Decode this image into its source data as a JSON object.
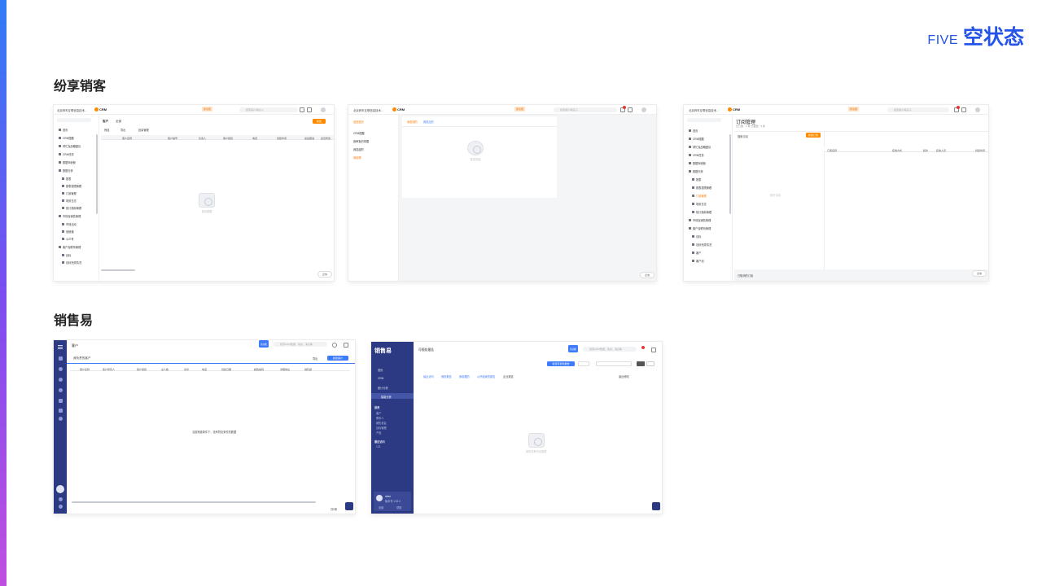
{
  "header": {
    "brand_en": "FIVE",
    "brand_zh": "空状态"
  },
  "sections": {
    "fenxiang_title": "纷享销客",
    "xiaoshouyi_title": "销售易"
  },
  "common": {
    "crm_label": "CRM",
    "badge_text": "新功能",
    "chat_label": "企信",
    "search_placeholder": "搜索客户/联系人"
  },
  "shot1": {
    "company": "北京奔车互联信息技术...",
    "nav": [
      "首页",
      "CRM提醒",
      "帮忙及战略团队",
      "CRM任务",
      "数据驾驶舱",
      "数据分析",
      "报表",
      "报表权限管理",
      "订阅管理",
      "场景日志",
      "统计指标管理",
      "市场及销售管理",
      "市场活动",
      "营销通",
      "公众号",
      "客户及联系管理",
      "目标",
      "目标完成情况"
    ],
    "tab": "客户",
    "filter": "全部",
    "toolbar": [
      "筛选",
      "导出",
      "批量管理"
    ],
    "new_btn": "新建",
    "columns": [
      "客户名称",
      "客户编号",
      "负责人",
      "客户级别",
      "电话",
      "创建时间",
      "最后跟进",
      "最近修改"
    ],
    "empty_text": "暂无数据"
  },
  "shot2": {
    "back": "返回首页",
    "nav": [
      "CRM提醒",
      "我审批的单据",
      "我发起的",
      "我处理"
    ],
    "tabs": [
      "我收到的",
      "我发出的"
    ],
    "empty_text": "暂无内容"
  },
  "shot3": {
    "title": "订阅管理",
    "subtitle": "已订阅：1 条 已发送：3 条",
    "nav": [
      "首页",
      "CRM提醒",
      "帮忙及战略团队",
      "CRM任务",
      "数据驾驶舱",
      "数据分析",
      "报表",
      "报表权限管理",
      "订阅管理",
      "场景日志",
      "统计指标管理",
      "市场及销售管理",
      "客户及联系管理",
      "目标",
      "目标完成情况",
      "客户",
      "客户池"
    ],
    "search_label": "搜索订阅",
    "new_btn": "新建订阅",
    "columns": [
      "订阅名称",
      "接收方式",
      "频次",
      "接收人员",
      "创建时间"
    ],
    "empty_text": "暂无订阅",
    "footer": "已取消的订阅"
  },
  "shot4": {
    "title": "客户",
    "view": "我负责的客户",
    "export_btn": "导出",
    "new_btn": "新建客户",
    "columns": [
      "客户名称",
      "客户所有人",
      "客户级别",
      "总人数",
      "省份",
      "电话",
      "创建日期",
      "邮政编码",
      "详细地址",
      "销售额"
    ],
    "empty_text": "当前筛选条件下，没有符合条件的数据",
    "footer": "共0条",
    "search_placeholder": "搜索CRM数据，动态，消息等"
  },
  "shot5": {
    "logo": "销售易",
    "title": "可视化报告",
    "new_btn": "新建可视化报告",
    "filters": [
      "最近访问",
      "我的报告",
      "我收藏的",
      "公开给我的报告",
      "企业报告"
    ],
    "sort": "最近修改",
    "nav": [
      "首页",
      "CRM",
      "统计分析",
      "智能分析"
    ],
    "sub_title": "报表",
    "sub_items": [
      "客户",
      "联系人",
      "销售机会",
      "目标管理",
      "产品"
    ],
    "group_title": "最近访问",
    "group_items": [
      "123"
    ],
    "user": "chen",
    "user_sub": "版本号 V18.0",
    "user_links": [
      "设置",
      "帮助"
    ],
    "empty_text": "暂时没有可见报表",
    "search_placeholder": "搜索CRM数据，动态，消息等"
  }
}
